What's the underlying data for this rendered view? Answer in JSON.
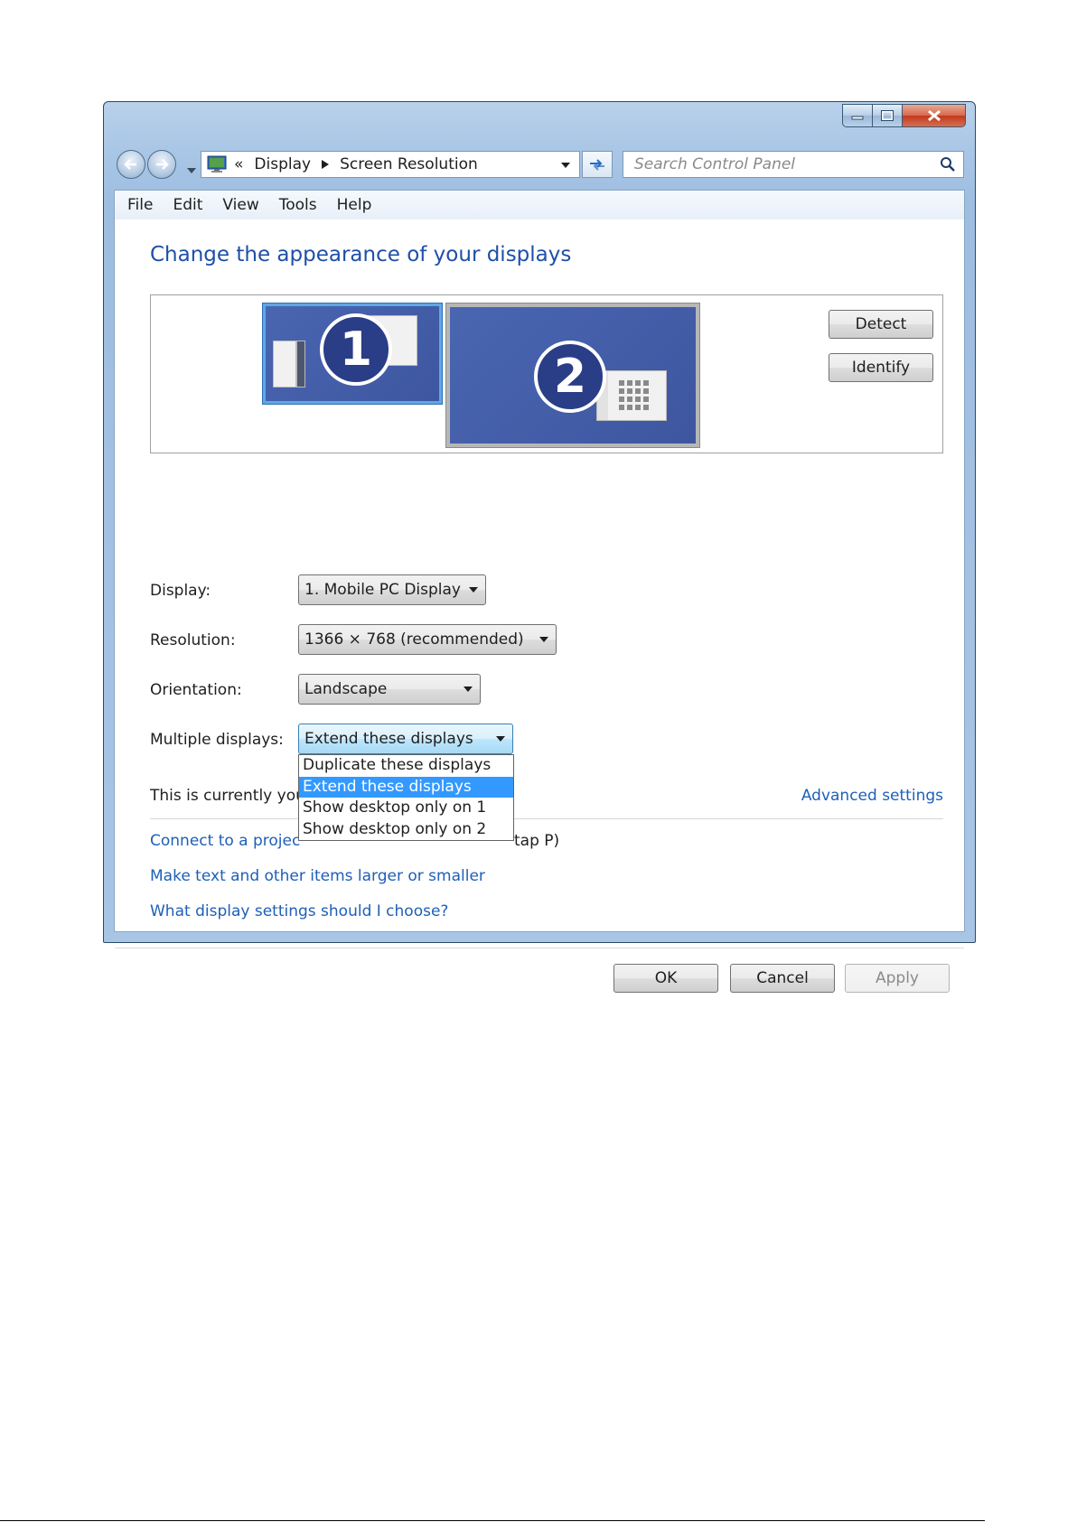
{
  "address": {
    "chevrons": "«",
    "crumb1": "Display",
    "crumb2": "Screen Resolution",
    "search_placeholder": "Search Control Panel"
  },
  "menu": [
    "File",
    "Edit",
    "View",
    "Tools",
    "Help"
  ],
  "page_title": "Change the appearance of your displays",
  "monitors": {
    "one": "1",
    "two": "2",
    "detect_label": "Detect",
    "identify_label": "Identify"
  },
  "fields": {
    "display_label": "Display:",
    "display_value": "1. Mobile PC Display",
    "resolution_label": "Resolution:",
    "resolution_value": "1366 × 768 (recommended)",
    "orientation_label": "Orientation:",
    "orientation_value": "Landscape",
    "multiple_label": "Multiple displays:",
    "multiple_value": "Extend these displays"
  },
  "dropdown_options": [
    "Duplicate these displays",
    "Extend these displays",
    "Show desktop only on 1",
    "Show desktop only on 2"
  ],
  "info": {
    "current_text": "This is currently you",
    "advanced_link": "Advanced settings"
  },
  "links": {
    "projector": "Connect to a projec",
    "projector_suffix": "tap P)",
    "text_size": "Make text and other items larger or smaller",
    "help": "What display settings should I choose?"
  },
  "buttons": {
    "ok": "OK",
    "cancel": "Cancel",
    "apply": "Apply"
  },
  "colors": {
    "link": "#1e5fb8",
    "title": "#1e4fa8",
    "selection": "#3399ff",
    "monitor": "#3e56a0"
  }
}
